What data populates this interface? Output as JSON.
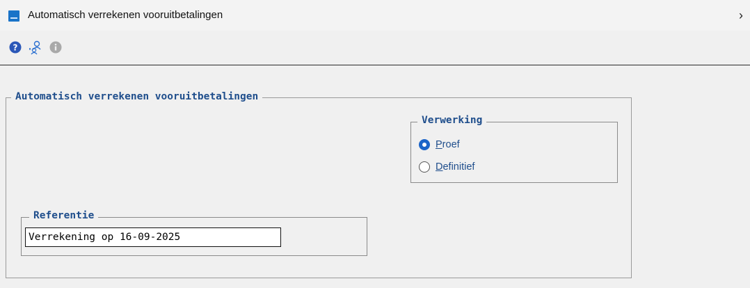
{
  "window": {
    "title": "Automatisch verrekenen vooruitbetalingen",
    "close_glyph": "›"
  },
  "toolbar": {
    "icons": [
      "help-icon",
      "users-icon",
      "info-icon"
    ]
  },
  "form": {
    "group_title": "Automatisch verrekenen vooruitbetalingen",
    "verwerking": {
      "title": "Verwerking",
      "options": [
        {
          "label": "Proef",
          "accel": "P",
          "rest": "roef",
          "checked": true
        },
        {
          "label": "Definitief",
          "accel": "D",
          "rest": "efinitief",
          "checked": false
        }
      ]
    },
    "referentie": {
      "title": "Referentie",
      "value": "Verrekening op 16-09-2025"
    }
  },
  "colors": {
    "accent": "#1a64c8",
    "label_text": "#1f4e8c",
    "background": "#f0f0f0"
  }
}
